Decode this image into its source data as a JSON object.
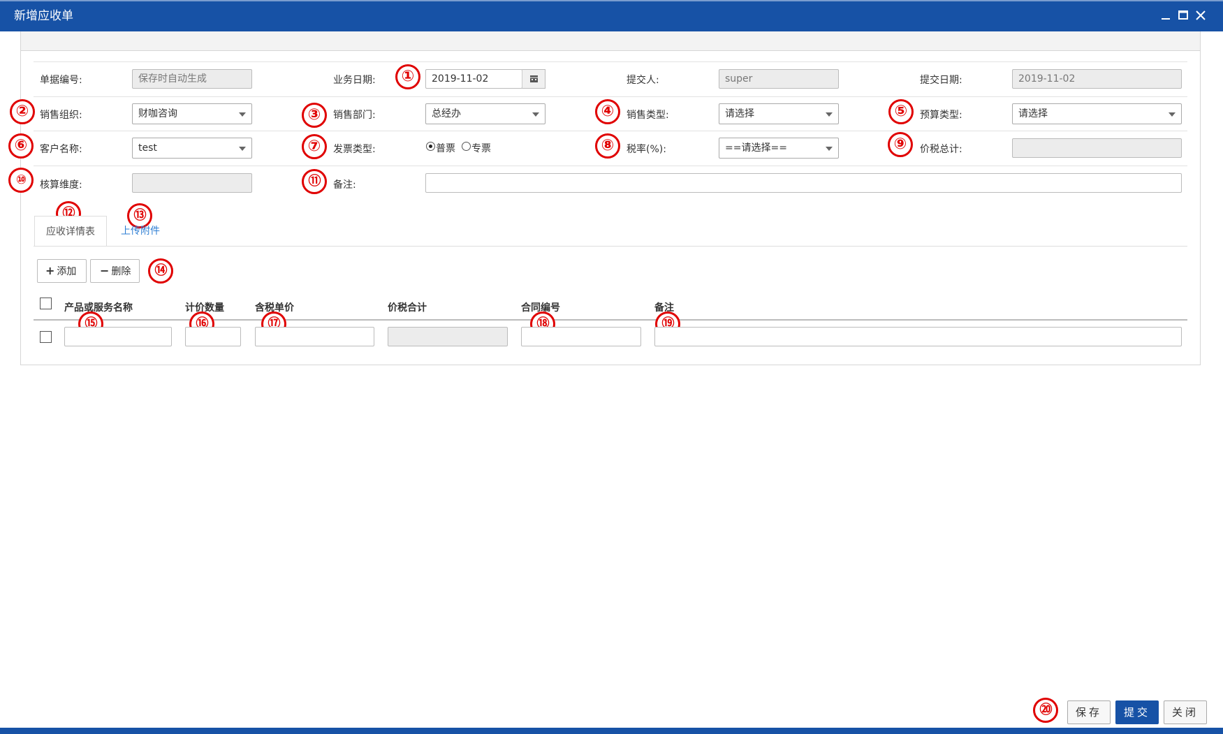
{
  "window": {
    "title": "新增应收单"
  },
  "form": {
    "doc_no": {
      "label": "单据编号:",
      "value": "保存时自动生成"
    },
    "biz_date": {
      "label": "业务日期:",
      "value": "2019-11-02"
    },
    "submitter": {
      "label": "提交人:",
      "value": "super"
    },
    "submit_date": {
      "label": "提交日期:",
      "value": "2019-11-02"
    },
    "sales_org": {
      "label": "销售组织:",
      "value": "财咖咨询"
    },
    "sales_dept": {
      "label": "销售部门:",
      "value": "总经办"
    },
    "sales_type": {
      "label": "销售类型:",
      "value": "请选择"
    },
    "budget_type": {
      "label": "预算类型:",
      "value": "请选择"
    },
    "customer": {
      "label": "客户名称:",
      "value": "test"
    },
    "invoice_type": {
      "label": "发票类型:",
      "options": [
        "普票",
        "专票"
      ],
      "selected": "普票"
    },
    "tax_rate": {
      "label": "税率(%):",
      "value": "==请选择=="
    },
    "total_tax": {
      "label": "价税总计:",
      "value": ""
    },
    "accounting_dim": {
      "label": "核算维度:",
      "value": ""
    },
    "remark": {
      "label": "备注:",
      "value": ""
    }
  },
  "tabs": [
    {
      "label": "应收详情表",
      "active": true
    },
    {
      "label": "上传附件",
      "active": false
    }
  ],
  "toolbar": {
    "add": "添加",
    "delete": "删除"
  },
  "table": {
    "columns": [
      "产品或服务名称",
      "计价数量",
      "含税单价",
      "价税合计",
      "合同编号",
      "备注"
    ],
    "rows": [
      [
        "",
        "",
        "",
        "",
        "",
        ""
      ]
    ]
  },
  "annotations": [
    "①",
    "②",
    "③",
    "④",
    "⑤",
    "⑥",
    "⑦",
    "⑧",
    "⑨",
    "⑩",
    "⑪",
    "⑫",
    "⑬",
    "⑭",
    "⑮",
    "⑯",
    "⑰",
    "⑱",
    "⑲",
    "⑳"
  ],
  "footer": {
    "save": "保存",
    "submit": "提交",
    "close": "关闭"
  },
  "colors": {
    "header_blue": "#1752a6",
    "annotation_red": "#e00000",
    "link_blue": "#2e7ed3"
  }
}
